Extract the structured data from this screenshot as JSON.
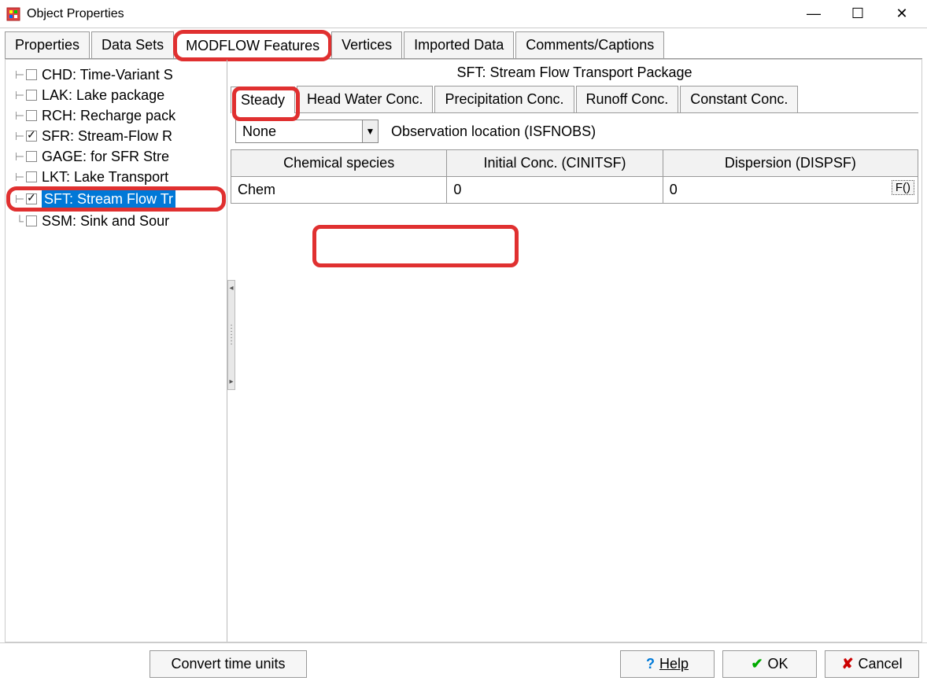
{
  "window": {
    "title": "Object Properties"
  },
  "tabs": {
    "items": [
      {
        "label": "Properties"
      },
      {
        "label": "Data Sets"
      },
      {
        "label": "MODFLOW Features"
      },
      {
        "label": "Vertices"
      },
      {
        "label": "Imported Data"
      },
      {
        "label": "Comments/Captions"
      }
    ]
  },
  "tree": {
    "items": [
      {
        "label": "CHD: Time-Variant S",
        "checked": false
      },
      {
        "label": "LAK: Lake package",
        "checked": false
      },
      {
        "label": "RCH: Recharge pack",
        "checked": false
      },
      {
        "label": "SFR: Stream-Flow R",
        "checked": true
      },
      {
        "label": "GAGE: for SFR Stre",
        "checked": false
      },
      {
        "label": "LKT: Lake Transport",
        "checked": false
      },
      {
        "label": "SFT: Stream Flow Tr",
        "checked": true,
        "selected": true
      },
      {
        "label": "SSM: Sink and Sour",
        "checked": false
      }
    ]
  },
  "panel": {
    "title": "SFT: Stream Flow Transport Package",
    "subtabs": [
      {
        "label": "Steady"
      },
      {
        "label": "Head Water Conc."
      },
      {
        "label": "Precipitation Conc."
      },
      {
        "label": "Runoff Conc."
      },
      {
        "label": "Constant Conc."
      }
    ],
    "obs": {
      "combo": "None",
      "label": "Observation location (ISFNOBS)"
    },
    "grid": {
      "headers": [
        "Chemical species",
        "Initial Conc. (CINITSF)",
        "Dispersion (DISPSF)"
      ],
      "rows": [
        {
          "species": "Chem",
          "initial": "0",
          "dispersion": "0",
          "fbtn": "F()"
        }
      ]
    }
  },
  "footer": {
    "convert": "Convert time units",
    "help": "Help",
    "ok": "OK",
    "cancel": "Cancel"
  }
}
